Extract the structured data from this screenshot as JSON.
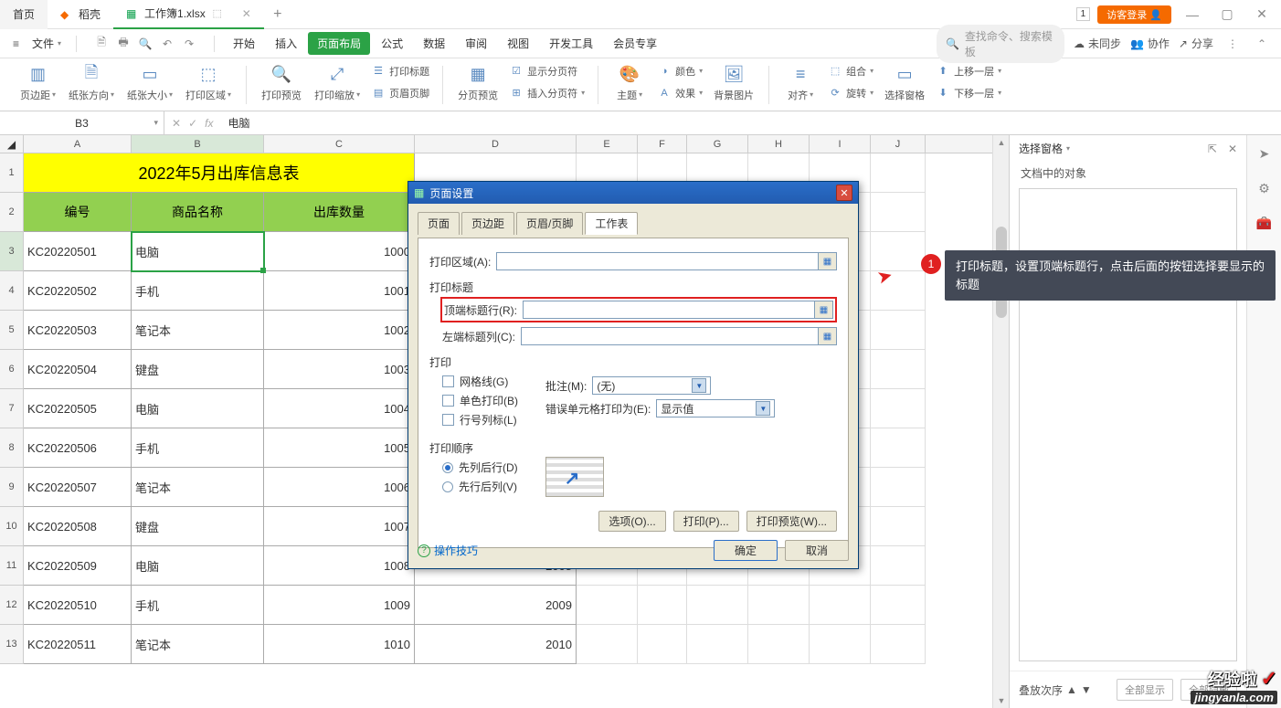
{
  "titlebar": {
    "tab_home": "首页",
    "tab_docer": "稻壳",
    "tab_file": "工作簿1.xlsx",
    "login": "访客登录",
    "badge": "1"
  },
  "menubar": {
    "file": "文件",
    "items": [
      "开始",
      "插入",
      "页面布局",
      "公式",
      "数据",
      "审阅",
      "视图",
      "开发工具",
      "会员专享"
    ],
    "active_index": 2,
    "search_placeholder": "查找命令、搜索模板",
    "sync": "未同步",
    "collab": "协作",
    "share": "分享"
  },
  "ribbon": {
    "g1": {
      "margins": "页边距",
      "orient": "纸张方向",
      "size": "纸张大小",
      "area": "打印区域"
    },
    "g2": {
      "preview": "打印预览",
      "scale": "打印缩放",
      "titles": "打印标题",
      "header": "页眉页脚"
    },
    "g3": {
      "split": "分页预览",
      "showsplit": "显示分页符",
      "insertsplit": "插入分页符"
    },
    "g4": {
      "themes": "主题",
      "colors": "颜色",
      "fonts": "效果",
      "bg": "背景图片"
    },
    "g5": {
      "align": "对齐",
      "group": "组合",
      "rotate": "旋转",
      "pane": "选择窗格",
      "forward": "上移一层",
      "backward": "下移一层"
    }
  },
  "formula": {
    "name_box": "B3",
    "fx_value": "电脑"
  },
  "sheet": {
    "cols": [
      "A",
      "B",
      "C",
      "D",
      "E",
      "F",
      "G",
      "H",
      "I",
      "J"
    ],
    "title": "2022年5月出库信息表",
    "headers": [
      "编号",
      "商品名称",
      "出库数量"
    ],
    "rows": [
      {
        "n": "3",
        "a": "KC20220501",
        "b": "电脑",
        "c": "1000",
        "d": ""
      },
      {
        "n": "4",
        "a": "KC20220502",
        "b": "手机",
        "c": "1001",
        "d": ""
      },
      {
        "n": "5",
        "a": "KC20220503",
        "b": "笔记本",
        "c": "1002",
        "d": ""
      },
      {
        "n": "6",
        "a": "KC20220504",
        "b": "键盘",
        "c": "1003",
        "d": ""
      },
      {
        "n": "7",
        "a": "KC20220505",
        "b": "电脑",
        "c": "1004",
        "d": ""
      },
      {
        "n": "8",
        "a": "KC20220506",
        "b": "手机",
        "c": "1005",
        "d": ""
      },
      {
        "n": "9",
        "a": "KC20220507",
        "b": "笔记本",
        "c": "1006",
        "d": ""
      },
      {
        "n": "10",
        "a": "KC20220508",
        "b": "键盘",
        "c": "1007",
        "d": ""
      },
      {
        "n": "11",
        "a": "KC20220509",
        "b": "电脑",
        "c": "1008",
        "d": "2008"
      },
      {
        "n": "12",
        "a": "KC20220510",
        "b": "手机",
        "c": "1009",
        "d": "2009"
      },
      {
        "n": "13",
        "a": "KC20220511",
        "b": "笔记本",
        "c": "1010",
        "d": "2010"
      }
    ]
  },
  "dialog": {
    "title": "页面设置",
    "tabs": [
      "页面",
      "页边距",
      "页眉/页脚",
      "工作表"
    ],
    "active_tab": 3,
    "print_area": "打印区域(A):",
    "print_titles": "打印标题",
    "top_row": "顶端标题行(R):",
    "left_col": "左端标题列(C):",
    "print": "打印",
    "gridlines": "网格线(G)",
    "mono": "单色打印(B)",
    "rowcol": "行号列标(L)",
    "comments": "批注(M):",
    "comments_val": "(无)",
    "errors": "错误单元格打印为(E):",
    "errors_val": "显示值",
    "order": "打印顺序",
    "order1": "先列后行(D)",
    "order2": "先行后列(V)",
    "btn_options": "选项(O)...",
    "btn_print": "打印(P)...",
    "btn_preview": "打印预览(W)...",
    "help": "操作技巧",
    "ok": "确定",
    "cancel": "取消"
  },
  "callout": {
    "num": "1",
    "text": "打印标题，设置顶端标题行，点击后面的按钮选择要显示的标题"
  },
  "taskpane": {
    "title": "选择窗格",
    "sub": "文档中的对象",
    "stack": "叠放次序",
    "show_all": "全部显示",
    "hide_all": "全部隐藏"
  },
  "watermark": {
    "l1": "经验啦",
    "l2": "jingyanla.com"
  }
}
